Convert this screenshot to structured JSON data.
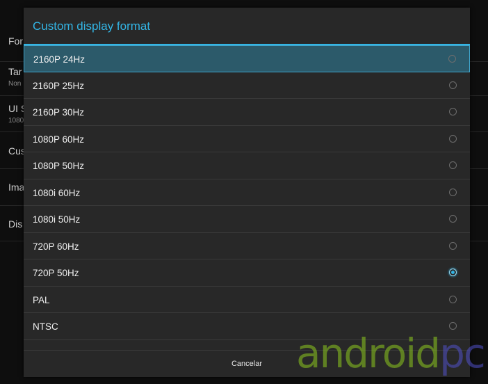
{
  "background": {
    "items": [
      {
        "title": "For",
        "subtitle": ""
      },
      {
        "title": "Tar",
        "subtitle": "Non"
      },
      {
        "title": "UI S",
        "subtitle": "1080"
      },
      {
        "title": "Cus",
        "subtitle": ""
      },
      {
        "title": "Ima",
        "subtitle": ""
      },
      {
        "title": "Dis",
        "subtitle": ""
      }
    ]
  },
  "dialog": {
    "title": "Custom display format",
    "accent_color": "#33b5e5",
    "options": [
      {
        "label": "2160P 24Hz",
        "checked": false,
        "highlighted": true
      },
      {
        "label": "2160P 25Hz",
        "checked": false,
        "highlighted": false
      },
      {
        "label": "2160P 30Hz",
        "checked": false,
        "highlighted": false
      },
      {
        "label": "1080P 60Hz",
        "checked": false,
        "highlighted": false
      },
      {
        "label": "1080P 50Hz",
        "checked": false,
        "highlighted": false
      },
      {
        "label": "1080i 60Hz",
        "checked": false,
        "highlighted": false
      },
      {
        "label": "1080i 50Hz",
        "checked": false,
        "highlighted": false
      },
      {
        "label": "720P 60Hz",
        "checked": false,
        "highlighted": false
      },
      {
        "label": "720P 50Hz",
        "checked": true,
        "highlighted": false
      },
      {
        "label": "PAL",
        "checked": false,
        "highlighted": false
      },
      {
        "label": "NTSC",
        "checked": false,
        "highlighted": false
      }
    ],
    "cancel_label": "Cancelar"
  },
  "watermark": {
    "part1": "android",
    "part2": "pc"
  }
}
